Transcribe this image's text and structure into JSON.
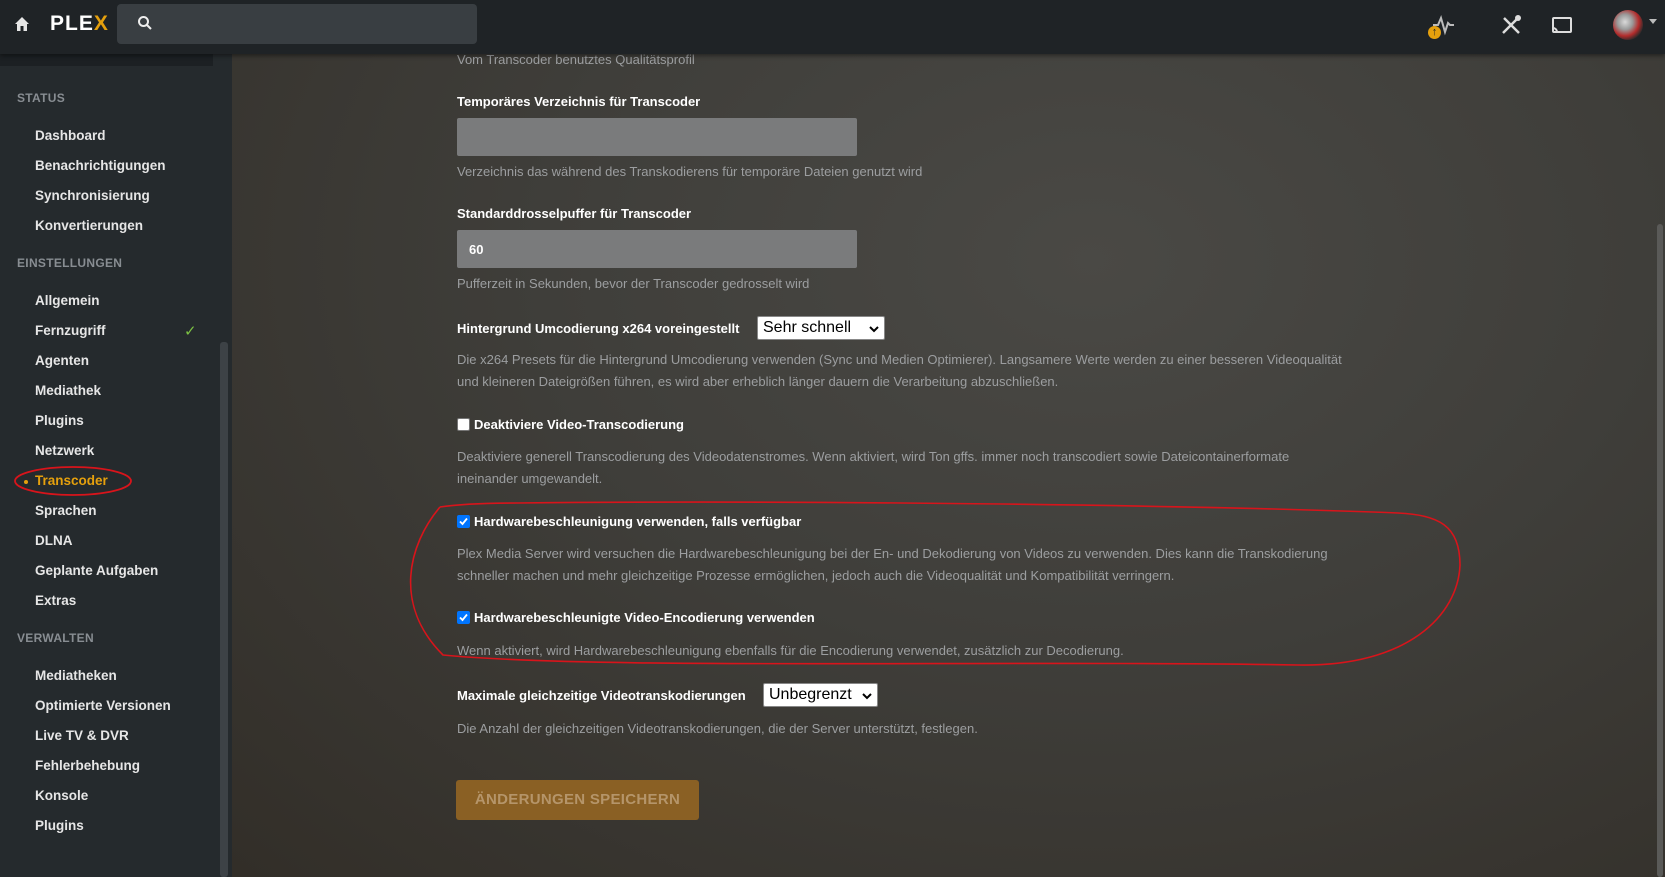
{
  "app": {
    "logo_main": "PLE",
    "logo_x": "X"
  },
  "topbar": {
    "search_placeholder": "",
    "icons": [
      "home-icon",
      "search-icon",
      "activity-icon",
      "settings-wrench-icon",
      "cast-icon",
      "avatar",
      "chevron-down-icon"
    ]
  },
  "sidebar": {
    "sections": {
      "status": "Status",
      "einstellungen": "Einstellungen",
      "verwalten": "Verwalten"
    },
    "status_items": [
      "Dashboard",
      "Benachrichtigungen",
      "Synchronisierung",
      "Konvertierungen"
    ],
    "settings_items": [
      "Allgemein",
      "Fernzugriff",
      "Agenten",
      "Mediathek",
      "Plugins",
      "Netzwerk",
      "Transcoder",
      "Sprachen",
      "DLNA",
      "Geplante Aufgaben",
      "Extras"
    ],
    "manage_items": [
      "Mediatheken",
      "Optimierte Versionen",
      "Live TV & DVR",
      "Fehlerbehebung",
      "Konsole",
      "Plugins"
    ],
    "active_item": "Transcoder",
    "checked_item": "Fernzugriff"
  },
  "main": {
    "quality_help": "Vom Transcoder benutztes Qualitätsprofil",
    "temp_dir": {
      "label": "Temporäres Verzeichnis für Transcoder",
      "value": "",
      "help": "Verzeichnis das während des Transkodierens für temporäre Dateien genutzt wird"
    },
    "throttle_buffer": {
      "label": "Standarddrosselpuffer für Transcoder",
      "value": "60",
      "help": "Pufferzeit in Sekunden, bevor der Transcoder gedrosselt wird"
    },
    "x264_preset": {
      "label": "Hintergrund Umcodierung x264 voreingestellt",
      "value": "Sehr schnell",
      "help_line1": "Die x264 Presets für die Hintergrund Umcodierung verwenden (Sync und Medien Optimierer). Langsamere Werte werden zu einer besseren Videoqualität",
      "help_line2": "und kleineren Dateigrößen führen, es wird aber erheblich länger dauern die Verarbeitung abzuschließen."
    },
    "disable_video_transcoding": {
      "label": "Deaktiviere Video-Transcodierung",
      "checked": false,
      "help_line1": "Deaktiviere generell Transcodierung des Videodatenstromes. Wenn aktiviert, wird Ton gffs. immer noch transcodiert sowie Dateicontainerformate",
      "help_line2": "ineinander umgewandelt."
    },
    "hw_acceleration": {
      "label": "Hardwarebeschleunigung verwenden, falls verfügbar",
      "checked": true,
      "help_line1": "Plex Media Server wird versuchen die Hardwarebeschleunigung bei der En- und Dekodierung von Videos zu verwenden. Dies kann die Transkodierung",
      "help_line2": "schneller machen und mehr gleichzeitige Prozesse ermöglichen, jedoch auch die Videoqualität und Kompatibilität verringern."
    },
    "hw_encoding": {
      "label": "Hardwarebeschleunigte Video-Encodierung verwenden",
      "checked": true,
      "help": "Wenn aktiviert, wird Hardwarebeschleunigung ebenfalls für die Encodierung verwendet, zusätzlich zur Decodierung."
    },
    "max_transcodes": {
      "label": "Maximale gleichzeitige Videotranskodierungen",
      "value": "Unbegrenzt",
      "help": "Die Anzahl der gleichzeitigen Videotranskodierungen, die der Server unterstützt, festlegen."
    },
    "save_label": "Änderungen speichern"
  },
  "colors": {
    "accent": "#e5a00d",
    "annotation": "#d8141b",
    "check": "#7bc043"
  }
}
